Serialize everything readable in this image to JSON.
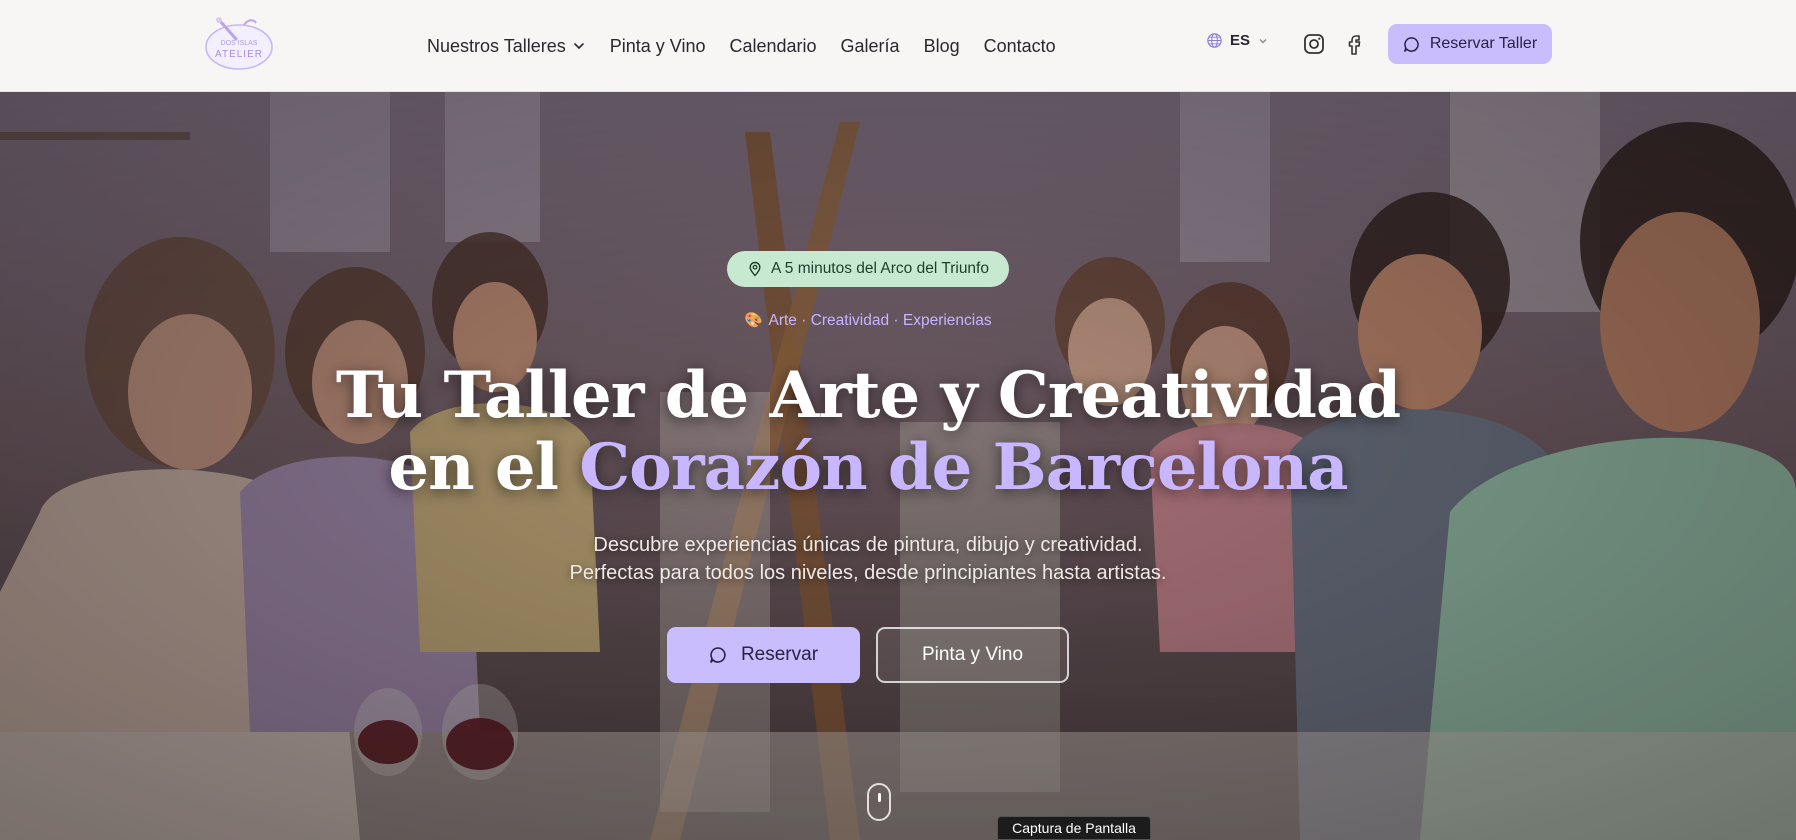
{
  "logo": {
    "line1": "DOS ISLAS",
    "line2": "ATELIER"
  },
  "nav": {
    "items": [
      {
        "label": "Nuestros Talleres",
        "has_dropdown": true
      },
      {
        "label": "Pinta y Vino"
      },
      {
        "label": "Calendario"
      },
      {
        "label": "Galería"
      },
      {
        "label": "Blog"
      },
      {
        "label": "Contacto"
      }
    ]
  },
  "language": {
    "selected": "ES",
    "icon": "globe-icon"
  },
  "social": {
    "instagram_icon": "instagram-icon",
    "facebook_icon": "facebook-icon"
  },
  "header_cta": {
    "label": "Reservar Taller",
    "icon": "message-circle-icon"
  },
  "hero": {
    "badge": {
      "text": "A 5 minutos del Arco del Triunfo",
      "icon": "map-pin-icon"
    },
    "tagline": {
      "emoji": "🎨",
      "text": "Arte · Creatividad · Experiencias"
    },
    "title_line1": "Tu Taller de Arte y Creatividad",
    "title_line2_prefix": "en el ",
    "title_line2_accent": "Corazón de Barcelona",
    "subtitle_line1": "Descubre experiencias únicas de pintura, dibujo y creatividad.",
    "subtitle_line2": "Perfectas para todos los niveles, desde principiantes hasta artistas.",
    "primary_button": "Reservar",
    "secondary_button": "Pinta y Vino"
  },
  "tooltip": "Captura de Pantalla",
  "colors": {
    "accent": "#c9bdfd",
    "accent_text": "#c8b6ff",
    "badge_bg": "#c7e9d2",
    "header_bg": "#f8f6f4"
  }
}
